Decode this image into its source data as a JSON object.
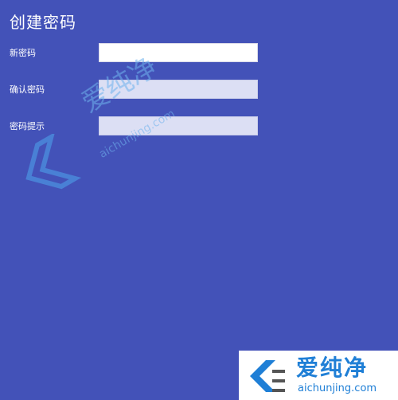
{
  "title": "创建密码",
  "fields": [
    {
      "label": "新密码",
      "value": ""
    },
    {
      "label": "确认密码",
      "value": ""
    },
    {
      "label": "密码提示",
      "value": ""
    }
  ],
  "watermark": {
    "cn": "爱纯净",
    "en": "aichunjing.com"
  },
  "colors": {
    "background": "#4352b8",
    "field_bg": "#ffffff",
    "field_dim_bg": "#dcdff4",
    "watermark_blue": "#1f7fd6"
  }
}
